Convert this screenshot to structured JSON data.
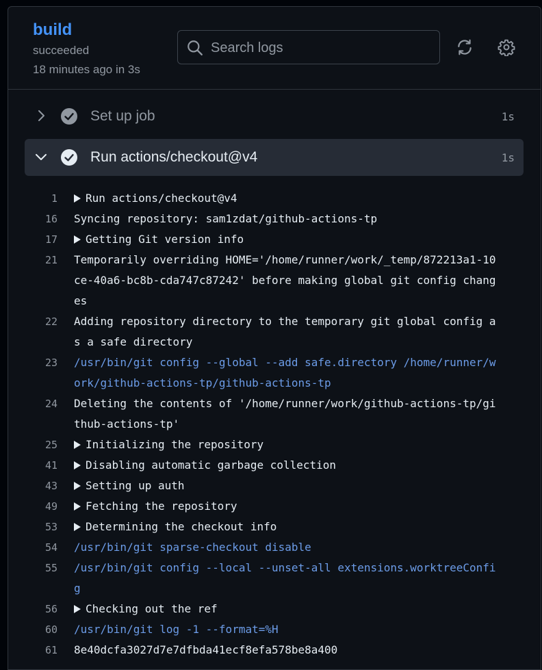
{
  "header": {
    "job_name": "build",
    "status": "succeeded",
    "time": "18 minutes ago in 3s",
    "search_placeholder": "Search logs"
  },
  "steps": [
    {
      "name": "Set up job",
      "duration": "1s",
      "expanded": false
    },
    {
      "name": "Run actions/checkout@v4",
      "duration": "1s",
      "expanded": true
    }
  ],
  "icons": {
    "search": "search-icon",
    "refresh": "refresh-icon",
    "settings": "gear-icon",
    "collapse": "chevron-right-icon",
    "expand": "chevron-down-icon",
    "success": "check-circle-icon",
    "group": "triangle-right-icon"
  },
  "colors": {
    "link": "#4493f8",
    "command": "#6c9ce8",
    "muted": "#9198a1",
    "active_row": "#262c36"
  },
  "log_lines": [
    {
      "n": "1",
      "text": "Run actions/checkout@v4",
      "kind": "group"
    },
    {
      "n": "16",
      "text": "Syncing repository: sam1zdat/github-actions-tp",
      "kind": "text"
    },
    {
      "n": "17",
      "text": "Getting Git version info",
      "kind": "group"
    },
    {
      "n": "21",
      "text": "Temporarily overriding HOME='/home/runner/work/_temp/872213a1-10ce-40a6-bc8b-cda747c87242' before making global git config changes",
      "kind": "text"
    },
    {
      "n": "22",
      "text": "Adding repository directory to the temporary git global config as a safe directory",
      "kind": "text"
    },
    {
      "n": "23",
      "text": "/usr/bin/git config --global --add safe.directory /home/runner/work/github-actions-tp/github-actions-tp",
      "kind": "cmd"
    },
    {
      "n": "24",
      "text": "Deleting the contents of '/home/runner/work/github-actions-tp/github-actions-tp'",
      "kind": "text"
    },
    {
      "n": "25",
      "text": "Initializing the repository",
      "kind": "group"
    },
    {
      "n": "41",
      "text": "Disabling automatic garbage collection",
      "kind": "group"
    },
    {
      "n": "43",
      "text": "Setting up auth",
      "kind": "group"
    },
    {
      "n": "49",
      "text": "Fetching the repository",
      "kind": "group"
    },
    {
      "n": "53",
      "text": "Determining the checkout info",
      "kind": "group"
    },
    {
      "n": "54",
      "text": "/usr/bin/git sparse-checkout disable",
      "kind": "cmd"
    },
    {
      "n": "55",
      "text": "/usr/bin/git config --local --unset-all extensions.worktreeConfig",
      "kind": "cmd"
    },
    {
      "n": "56",
      "text": "Checking out the ref",
      "kind": "group"
    },
    {
      "n": "60",
      "text": "/usr/bin/git log -1 --format=%H",
      "kind": "cmd"
    },
    {
      "n": "61",
      "text": "8e40dcfa3027d7e7dfbda41ecf8efa578be8a400",
      "kind": "text"
    }
  ]
}
